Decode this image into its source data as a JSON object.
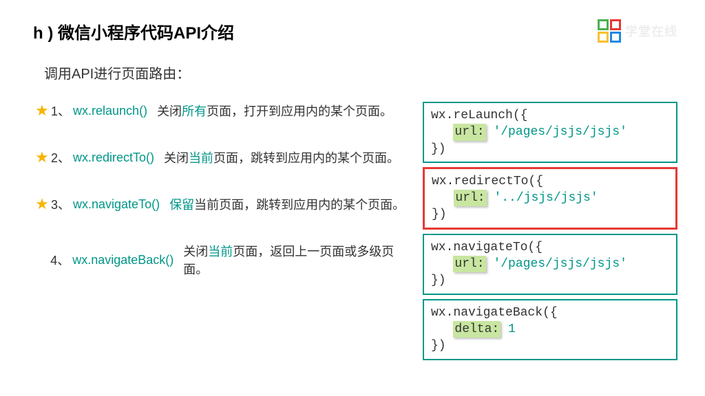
{
  "header": {
    "title": "h ) 微信小程序代码API介绍",
    "brand": "学堂在线"
  },
  "subtitle": "调用API进行页面路由：",
  "apis": [
    {
      "idx": "1、",
      "name": "wx.relaunch()",
      "starred": true,
      "desc_pre": "关闭",
      "desc_hl": "所有",
      "desc_post": "页面，打开到应用内的某个页面。"
    },
    {
      "idx": "2、",
      "name": "wx.redirectTo()",
      "starred": true,
      "desc_pre": "关闭",
      "desc_hl": "当前",
      "desc_post": "页面，跳转到应用内的某个页面。"
    },
    {
      "idx": "3、",
      "name": "wx.navigateTo()",
      "starred": true,
      "desc_pre": "",
      "desc_hl": "保留",
      "desc_post": "当前页面，跳转到应用内的某个页面。"
    },
    {
      "idx": "4、",
      "name": "wx.navigateBack()",
      "starred": false,
      "desc_pre": "关闭",
      "desc_hl": "当前",
      "desc_post": "页面，返回上一页面或多级页面。"
    }
  ],
  "snippets": [
    {
      "highlighted": false,
      "line1": "wx.reLaunch({",
      "key": "url:",
      "val": "'/pages/jsjs/jsjs'",
      "line3": "})"
    },
    {
      "highlighted": true,
      "line1": "wx.redirectTo({",
      "key": "url:",
      "val": "'../jsjs/jsjs'",
      "line3": "})"
    },
    {
      "highlighted": false,
      "line1": "wx.navigateTo({",
      "key": "url:",
      "val": "'/pages/jsjs/jsjs'",
      "line3": "})"
    },
    {
      "highlighted": false,
      "line1": "wx.navigateBack({",
      "key": "delta:",
      "val": "1",
      "line3": "})"
    }
  ]
}
